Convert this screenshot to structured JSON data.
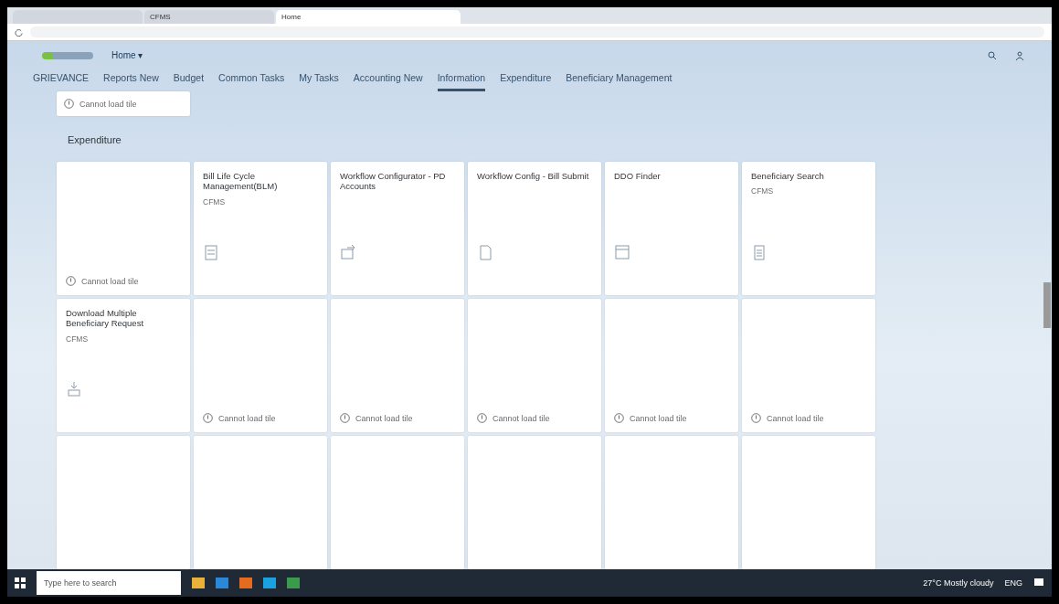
{
  "browser": {
    "tabs": [
      {
        "selected": false
      },
      {
        "title": "CFMS",
        "selected": false
      },
      {
        "title": "Home",
        "selected": true
      }
    ]
  },
  "shell": {
    "home": "Home ▾"
  },
  "nav": [
    {
      "label": "GRIEVANCE",
      "selected": false
    },
    {
      "label": "Reports New",
      "selected": false
    },
    {
      "label": "Budget",
      "selected": false
    },
    {
      "label": "Common Tasks",
      "selected": false
    },
    {
      "label": "My Tasks",
      "selected": false
    },
    {
      "label": "Accounting New",
      "selected": false
    },
    {
      "label": "Information",
      "selected": true
    },
    {
      "label": "Expenditure",
      "selected": false
    },
    {
      "label": "Beneficiary Management",
      "selected": false
    }
  ],
  "top_tile": {
    "error": "Cannot load tile"
  },
  "section": {
    "title": "Expenditure"
  },
  "tiles": [
    {
      "kind": "error",
      "error": "Cannot load tile"
    },
    {
      "kind": "app",
      "title": "Bill Life Cycle Management(BLM)",
      "subtitle": "CFMS"
    },
    {
      "kind": "app",
      "title": "Workflow Configurator - PD Accounts"
    },
    {
      "kind": "app",
      "title": "Workflow Config - Bill Submit"
    },
    {
      "kind": "app",
      "title": "DDO Finder"
    },
    {
      "kind": "app",
      "title": "Beneficiary Search",
      "subtitle": "CFMS"
    },
    {
      "kind": "app",
      "title": "Download Multiple Beneficiary Request",
      "subtitle": "CFMS"
    },
    {
      "kind": "error",
      "error": "Cannot load tile"
    },
    {
      "kind": "error",
      "error": "Cannot load tile"
    },
    {
      "kind": "error",
      "error": "Cannot load tile"
    },
    {
      "kind": "error",
      "error": "Cannot load tile"
    },
    {
      "kind": "error",
      "error": "Cannot load tile"
    },
    {
      "kind": "empty"
    },
    {
      "kind": "empty"
    },
    {
      "kind": "empty"
    },
    {
      "kind": "empty"
    },
    {
      "kind": "empty"
    },
    {
      "kind": "empty"
    }
  ],
  "taskbar": {
    "search_placeholder": "Type here to search",
    "weather": "27°C  Mostly cloudy",
    "lang": "ENG"
  }
}
